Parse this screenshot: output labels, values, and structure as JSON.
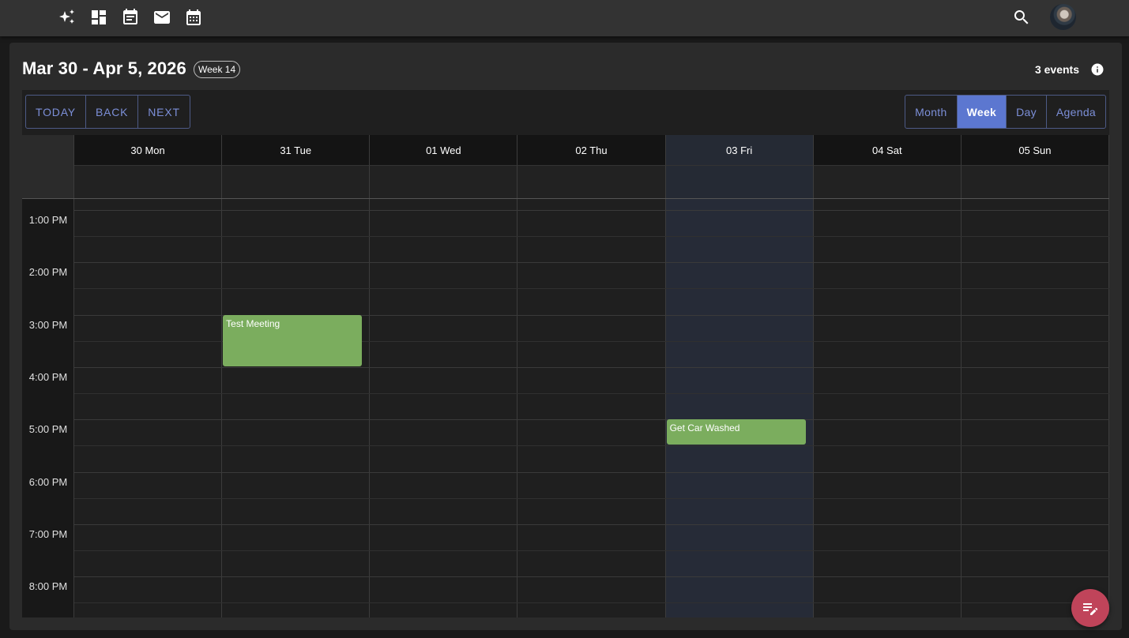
{
  "nav": {
    "icons": [
      "sparkle-icon",
      "dashboard-icon",
      "event-note-icon",
      "mail-icon",
      "calendar-icon"
    ],
    "search_icon": "search-icon",
    "avatar": "avatar"
  },
  "header": {
    "title": "Mar 30 - Apr 5, 2026",
    "week_chip": "Week 14",
    "event_count": "3 events"
  },
  "toolbar": {
    "nav_buttons": [
      "TODAY",
      "BACK",
      "NEXT"
    ],
    "view_buttons": [
      "Month",
      "Week",
      "Day",
      "Agenda"
    ],
    "active_view": "Week"
  },
  "calendar": {
    "days": [
      {
        "label": "30 Mon",
        "today": false
      },
      {
        "label": "31 Tue",
        "today": false
      },
      {
        "label": "01 Wed",
        "today": false
      },
      {
        "label": "02 Thu",
        "today": false
      },
      {
        "label": "03 Fri",
        "today": true
      },
      {
        "label": "04 Sat",
        "today": false
      },
      {
        "label": "05 Sun",
        "today": false
      }
    ],
    "times": [
      "1:00 PM",
      "2:00 PM",
      "3:00 PM",
      "4:00 PM",
      "5:00 PM",
      "6:00 PM",
      "7:00 PM",
      "8:00 PM"
    ],
    "events": [
      {
        "title": "Test Meeting",
        "day": "31 Tue",
        "start": "3:00 PM",
        "end": "4:00 PM"
      },
      {
        "title": "Get Car Washed",
        "day": "03 Fri",
        "start": "5:00 PM",
        "end": "5:30 PM"
      }
    ]
  },
  "colors": {
    "accent": "#5c77d0",
    "event": "#7bad5e",
    "fab": "#c0445a"
  }
}
